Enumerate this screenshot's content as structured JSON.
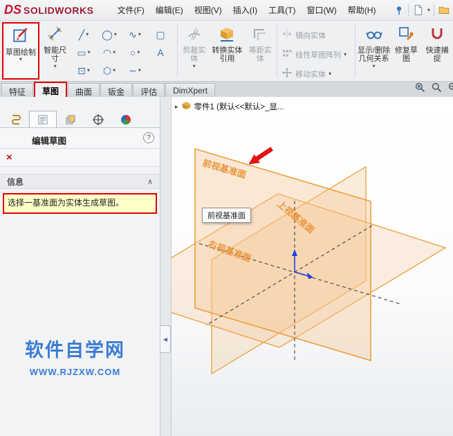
{
  "titlebar": {
    "logo_ds": "DS",
    "logo_text": "SOLIDWORKS",
    "menus": [
      "文件(F)",
      "编辑(E)",
      "视图(V)",
      "插入(I)",
      "工具(T)",
      "窗口(W)",
      "帮助(H)"
    ]
  },
  "icons": {
    "caret_down": "▾",
    "flyout_caret": "▸",
    "chevron_up": "∧",
    "close": "×",
    "help": "?",
    "panel_collapse": "◀"
  },
  "ribbon": {
    "sketch_label": "草图绘制",
    "smart_dimension_label": "智能尺寸",
    "tool_icons": [
      {
        "name": "line-icon",
        "glyph": "╱"
      },
      {
        "name": "circle-icon",
        "glyph": "◯"
      },
      {
        "name": "spline-icon",
        "glyph": "∿"
      },
      {
        "name": "sketch-picture-icon",
        "glyph": "▢"
      },
      {
        "name": "rectangle-icon",
        "glyph": "▭"
      },
      {
        "name": "arc-icon",
        "glyph": "◠"
      },
      {
        "name": "ellipse-icon",
        "glyph": "○"
      },
      {
        "name": "text-icon",
        "glyph": "A"
      },
      {
        "name": "point-icon",
        "glyph": "⊡"
      },
      {
        "name": "polygon-icon",
        "glyph": "⬡"
      },
      {
        "name": "curve-icon",
        "glyph": "∼"
      }
    ],
    "trim_label": "剪裁实体",
    "convert_label": "转换实体引用",
    "offset_label": "等距实体",
    "mirror_label": "镜向实体",
    "linear_pattern_label": "线性草图阵列",
    "move_label": "移动实体",
    "display_relations_label": "显示/删除几何关系",
    "repair_label": "修复草图",
    "quick_snaps_label": "快速捕捉"
  },
  "tabbar": {
    "tabs": [
      "特征",
      "草图",
      "曲面",
      "钣金",
      "评估",
      "DimXpert"
    ],
    "active_tab": "草图"
  },
  "property_manager": {
    "title": "编辑草图",
    "section_label": "信息",
    "message": "选择一基准面为实体生成草图。"
  },
  "watermark": {
    "line1": "软件自学网",
    "line2": "WWW.RJZXW.COM"
  },
  "graphics": {
    "tree_root": "零件1 (默认<<默认>_显...",
    "front_plane_label": "前视基准面",
    "top_plane_label": "上视基准面",
    "right_plane_label": "右视基准面",
    "tooltip": "前视基准面"
  },
  "colors": {
    "highlight_red": "#e00000",
    "plane_orange": "#ee9e3a",
    "message_yellow": "#ffffc9",
    "watermark_blue": "#3b7cd5",
    "logo_red": "#c8102e",
    "origin_blue": "#2040dd"
  }
}
